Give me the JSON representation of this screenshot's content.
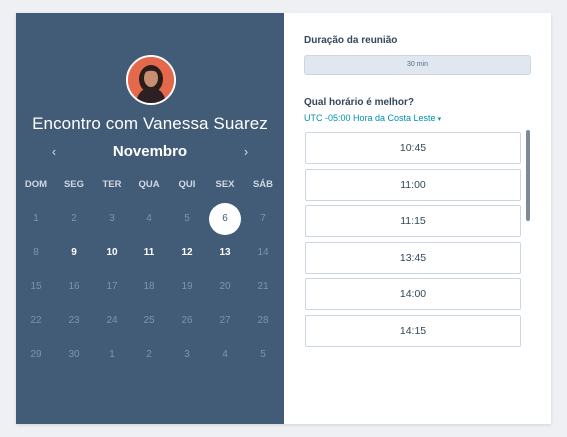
{
  "host": {
    "title": "Encontro com Vanessa Suarez",
    "avatar_icon": "person-avatar"
  },
  "calendar": {
    "month": "Novembro",
    "prev_icon": "chevron-left-icon",
    "next_icon": "chevron-right-icon",
    "prev_glyph": "‹",
    "next_glyph": "›",
    "weekdays": [
      "DOM",
      "SEG",
      "TER",
      "QUA",
      "QUI",
      "SEX",
      "SÁB"
    ],
    "weeks": [
      [
        {
          "d": "1",
          "state": "disabled"
        },
        {
          "d": "2",
          "state": "disabled"
        },
        {
          "d": "3",
          "state": "disabled"
        },
        {
          "d": "4",
          "state": "disabled"
        },
        {
          "d": "5",
          "state": "disabled"
        },
        {
          "d": "6",
          "state": "selected"
        },
        {
          "d": "7",
          "state": "disabled"
        }
      ],
      [
        {
          "d": "8",
          "state": "disabled"
        },
        {
          "d": "9",
          "state": "available"
        },
        {
          "d": "10",
          "state": "available"
        },
        {
          "d": "11",
          "state": "available"
        },
        {
          "d": "12",
          "state": "available"
        },
        {
          "d": "13",
          "state": "available"
        },
        {
          "d": "14",
          "state": "disabled"
        }
      ],
      [
        {
          "d": "15",
          "state": "disabled"
        },
        {
          "d": "16",
          "state": "disabled"
        },
        {
          "d": "17",
          "state": "disabled"
        },
        {
          "d": "18",
          "state": "disabled"
        },
        {
          "d": "19",
          "state": "disabled"
        },
        {
          "d": "20",
          "state": "disabled"
        },
        {
          "d": "21",
          "state": "disabled"
        }
      ],
      [
        {
          "d": "22",
          "state": "disabled"
        },
        {
          "d": "23",
          "state": "disabled"
        },
        {
          "d": "24",
          "state": "disabled"
        },
        {
          "d": "25",
          "state": "disabled"
        },
        {
          "d": "26",
          "state": "disabled"
        },
        {
          "d": "27",
          "state": "disabled"
        },
        {
          "d": "28",
          "state": "disabled"
        }
      ],
      [
        {
          "d": "29",
          "state": "disabled"
        },
        {
          "d": "30",
          "state": "disabled"
        },
        {
          "d": "1",
          "state": "disabled"
        },
        {
          "d": "2",
          "state": "disabled"
        },
        {
          "d": "3",
          "state": "disabled"
        },
        {
          "d": "4",
          "state": "disabled"
        },
        {
          "d": "5",
          "state": "disabled"
        }
      ]
    ]
  },
  "duration": {
    "label": "Duração da reunião",
    "value": "30 min"
  },
  "times": {
    "label": "Qual horário é melhor?",
    "timezone": "UTC -05:00 Hora da Costa Leste",
    "timezone_icon": "caret-down-icon",
    "caret_glyph": "▾",
    "slots": [
      "10:45",
      "11:00",
      "11:15",
      "13:45",
      "14:00",
      "14:15"
    ]
  },
  "colors": {
    "panel": "#425b76",
    "accent": "#0091ae",
    "border": "#cbd6e2"
  }
}
